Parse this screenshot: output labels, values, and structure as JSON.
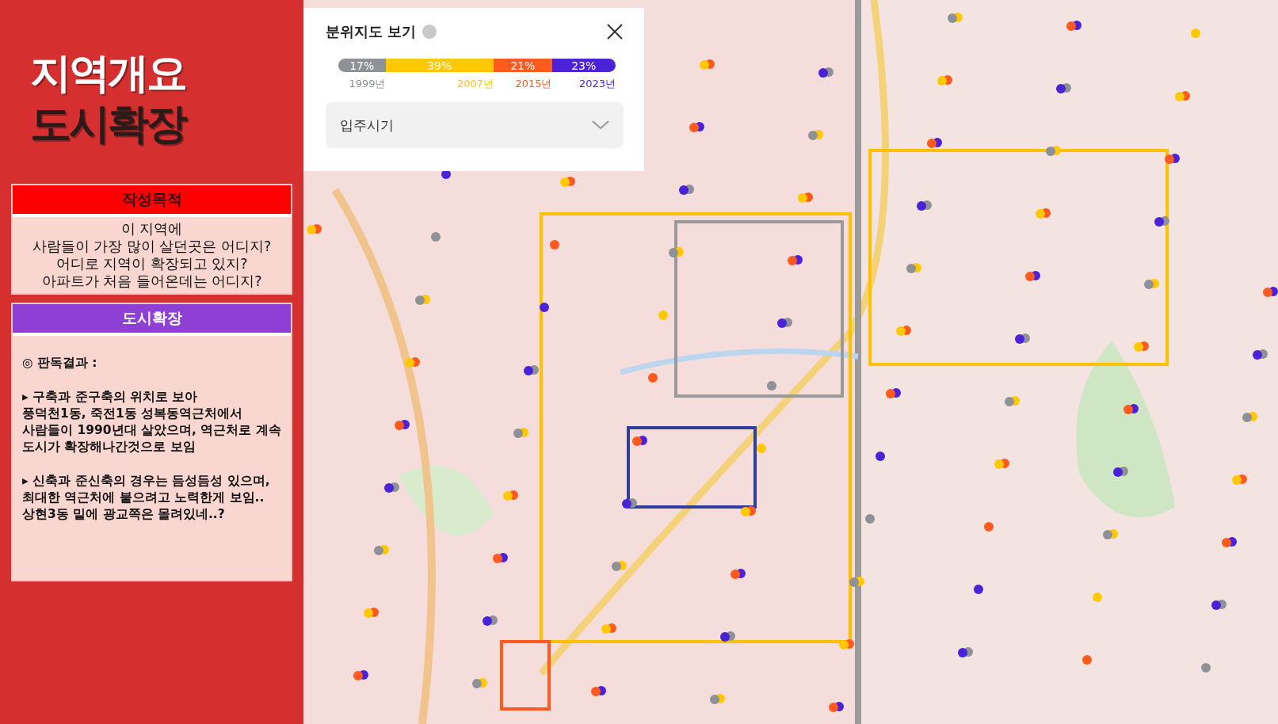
{
  "sidebar": {
    "title_lines": [
      {
        "text": "지역개요",
        "color": "#ffffff"
      },
      {
        "text": "도시확장",
        "color": "#2a1a1a"
      }
    ],
    "sections": [
      {
        "header": "작성목적",
        "kind": "centered",
        "paragraphs": [
          "이 지역에\n사람들이 가장 많이 살던곳은 어디지?\n어디로 지역이 확장되고 있지?\n아파트가 처음 들어온데는 어디지?"
        ]
      },
      {
        "header": "도시확장",
        "kind": "left",
        "paragraphs": [
          "◎ 판독결과 :",
          "▸ 구축과 준구축의 위치로 보아\n풍덕천1동, 죽전1동 성복동역근처에서 사람들이 1990년대 살았으며, 역근처로 계속 도시가 확장해나간것으로 보임",
          "▸ 신축과 준신축의 경우는 듬성듬성 있으며, 최대한 역근처에 붙으려고 노력한게 보임.. 상현3동 밑에 광교쪽은 몰려있네..?"
        ]
      }
    ]
  },
  "map_panel": {
    "title": "분위지도 보기",
    "segments": [
      {
        "label": "17%",
        "color": "#8e9196",
        "year": "1999년"
      },
      {
        "label": "39%",
        "color": "#ffc800",
        "year": "2007년"
      },
      {
        "label": "21%",
        "color": "#ff5a1f",
        "year": "2015년"
      },
      {
        "label": "23%",
        "color": "#4a22d8",
        "year": "2023년"
      }
    ],
    "dropdown": {
      "value": "입주시기"
    }
  }
}
